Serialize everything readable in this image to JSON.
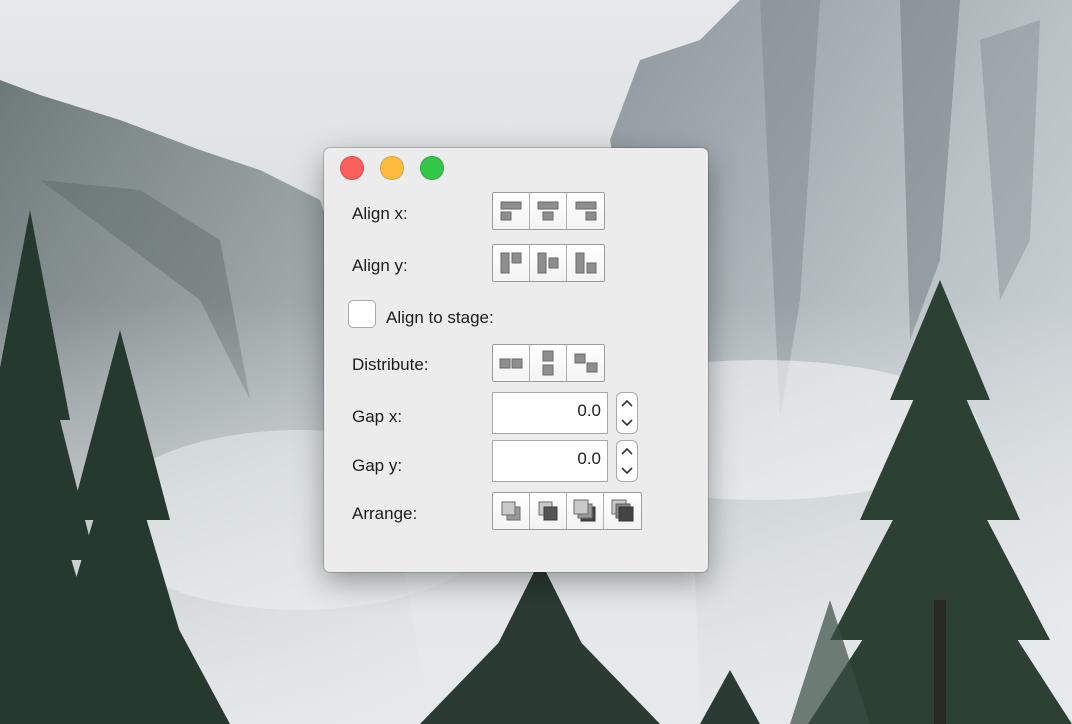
{
  "window": {
    "traffic_lights": {
      "close_color": "#fc605c",
      "minimize_color": "#fdbc40",
      "zoom_color": "#34c84a"
    }
  },
  "panel": {
    "align_x": {
      "label": "Align x:",
      "buttons": [
        "align-left-icon",
        "align-center-x-icon",
        "align-right-icon"
      ]
    },
    "align_y": {
      "label": "Align y:",
      "buttons": [
        "align-top-icon",
        "align-center-y-icon",
        "align-bottom-icon"
      ]
    },
    "align_to_stage": {
      "label": "Align to stage:",
      "checked": false
    },
    "distribute": {
      "label": "Distribute:",
      "buttons": [
        "distribute-horizontal-icon",
        "distribute-vertical-icon",
        "distribute-diagonal-icon"
      ]
    },
    "gap_x": {
      "label": "Gap x:",
      "value": "0.0"
    },
    "gap_y": {
      "label": "Gap y:",
      "value": "0.0"
    },
    "arrange": {
      "label": "Arrange:",
      "buttons": [
        "bring-to-front-icon",
        "bring-forward-icon",
        "send-backward-icon",
        "send-to-back-icon"
      ]
    }
  }
}
